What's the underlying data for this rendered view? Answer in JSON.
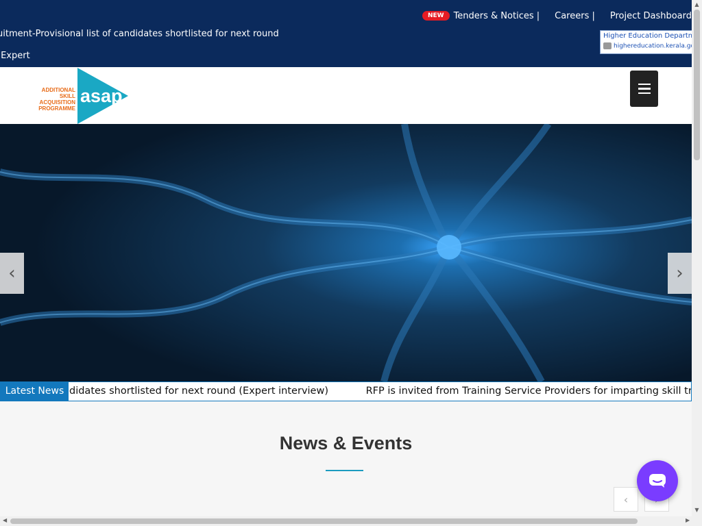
{
  "top_marquee": {
    "line1": "uitment-Provisional list of candidates shortlisted for next round (Expert",
    "line2": ")"
  },
  "top_links": {
    "new_badge": "NEW",
    "tenders": "Tenders & Notices |",
    "careers": "Careers |",
    "dashboard": "Project Dashboard"
  },
  "hed_badge": {
    "line1": "Higher Education Department",
    "line2": "highereducation.kerala.gov.in"
  },
  "logo": {
    "line1": "ADDITIONAL",
    "line2": "SKILL ACQUISITION",
    "line3": "PROGRAMME",
    "mark_text": "asap"
  },
  "news": {
    "label": "Latest News",
    "items": [
      "didates shortlisted for next round (Expert interview)",
      "RFP is invited from Training Service Providers for imparting skill training"
    ]
  },
  "section": {
    "title": "News & Events"
  },
  "icons": {
    "menu": "hamburger-menu-icon",
    "prev": "chevron-left-icon",
    "next": "chevron-right-icon",
    "chat": "chat-bubble-icon"
  },
  "colors": {
    "topbar": "#0b2a5c",
    "accent": "#1378bd",
    "logo_teal": "#1aa8c4",
    "logo_orange": "#e86c19",
    "chat": "#7a3cff"
  }
}
